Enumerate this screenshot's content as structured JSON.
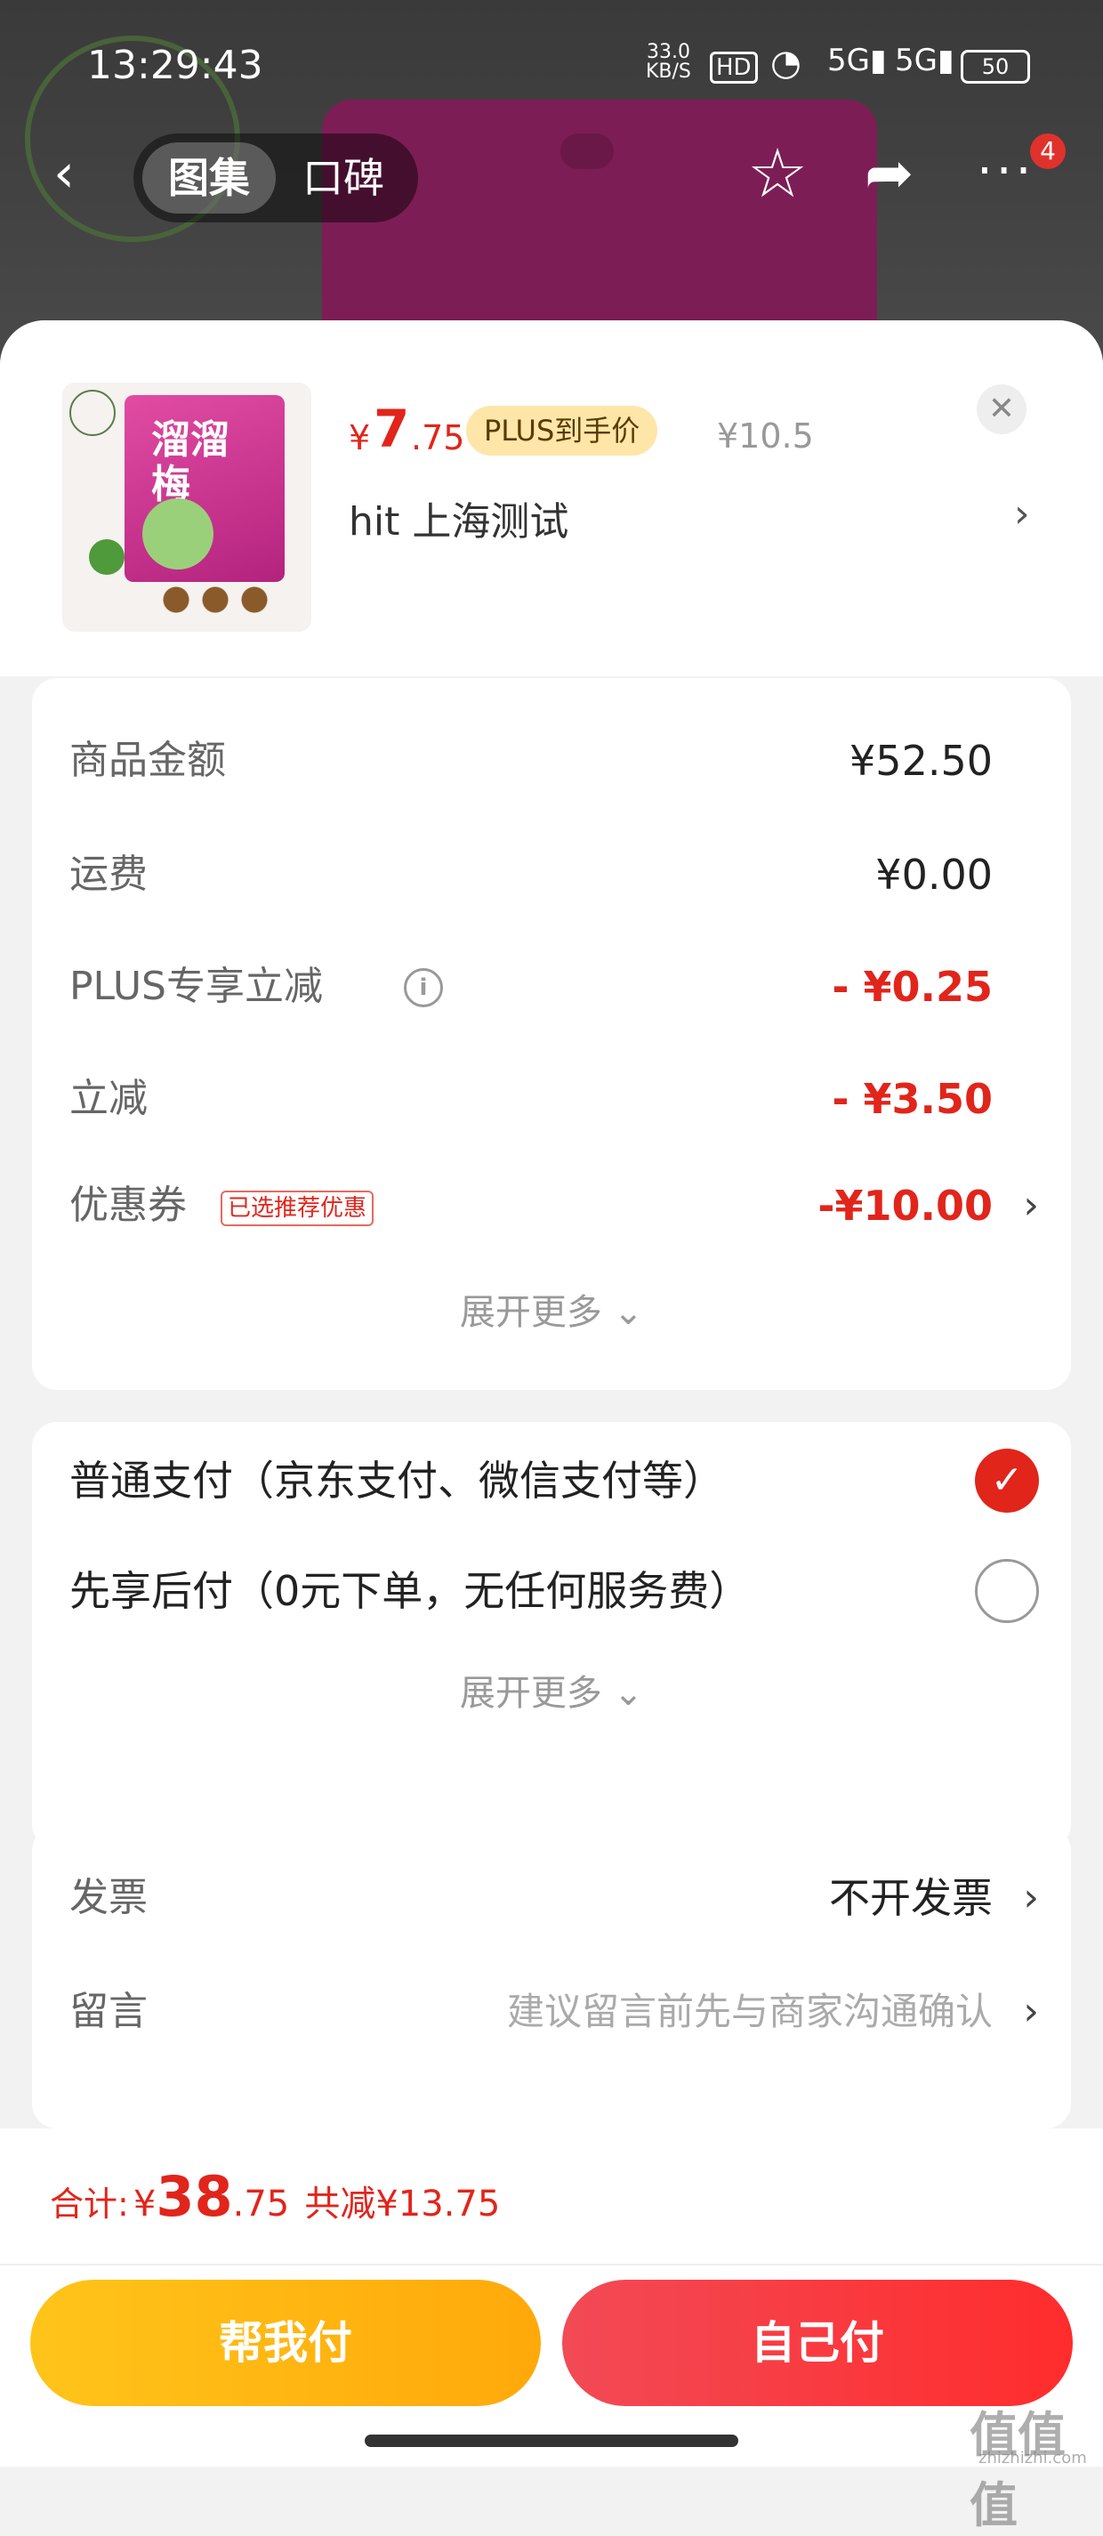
{
  "status_bar": {
    "time": "13:29:43",
    "network_speed": "33.0",
    "network_unit": "KB/S",
    "hd": "HD",
    "signal_1": "5G",
    "signal_2": "5G",
    "battery": "50"
  },
  "nav": {
    "tabs": [
      {
        "label": "图集"
      },
      {
        "label": "口碑"
      }
    ],
    "badge_count": "4"
  },
  "product": {
    "price_currency": "¥",
    "price_integer": "7",
    "price_decimal": ".75",
    "plus_badge": "PLUS到手价",
    "original_price": "¥10.5",
    "spec": "hit  上海测试",
    "image_text": "溜溜梅"
  },
  "summary": {
    "rows": [
      {
        "label": "商品金额",
        "value": "¥52.50"
      },
      {
        "label": "运费",
        "value": "¥0.00"
      },
      {
        "label": "PLUS专享立减",
        "value": "- ¥0.25"
      },
      {
        "label": "立减",
        "value": "- ¥3.50"
      },
      {
        "label": "优惠券",
        "value": "-¥10.00",
        "tag": "已选推荐优惠"
      }
    ],
    "expand_label": "展开更多"
  },
  "payment": {
    "options": [
      {
        "label": "普通支付（京东支付、微信支付等）",
        "selected": true
      },
      {
        "label": "先享后付（0元下单，无任何服务费）",
        "selected": false
      }
    ],
    "expand_label": "展开更多"
  },
  "extras": {
    "invoice_label": "发票",
    "invoice_value": "不开发票",
    "message_label": "留言",
    "message_placeholder": "建议留言前先与商家沟通确认"
  },
  "footer": {
    "total_label": "合计:",
    "total_currency": "¥",
    "total_integer": "38",
    "total_decimal": ".75",
    "total_saved": "共减¥13.75",
    "btn_friend": "帮我付",
    "btn_self": "自己付"
  },
  "watermark": {
    "main": "值值值",
    "sub": "zhizhizhi.com"
  },
  "colors": {
    "accent_red": "#e1251b",
    "plus_badge_bg": "#fde6a8",
    "btn_friend": "#ffb414",
    "btn_self": "#f43a3a"
  }
}
